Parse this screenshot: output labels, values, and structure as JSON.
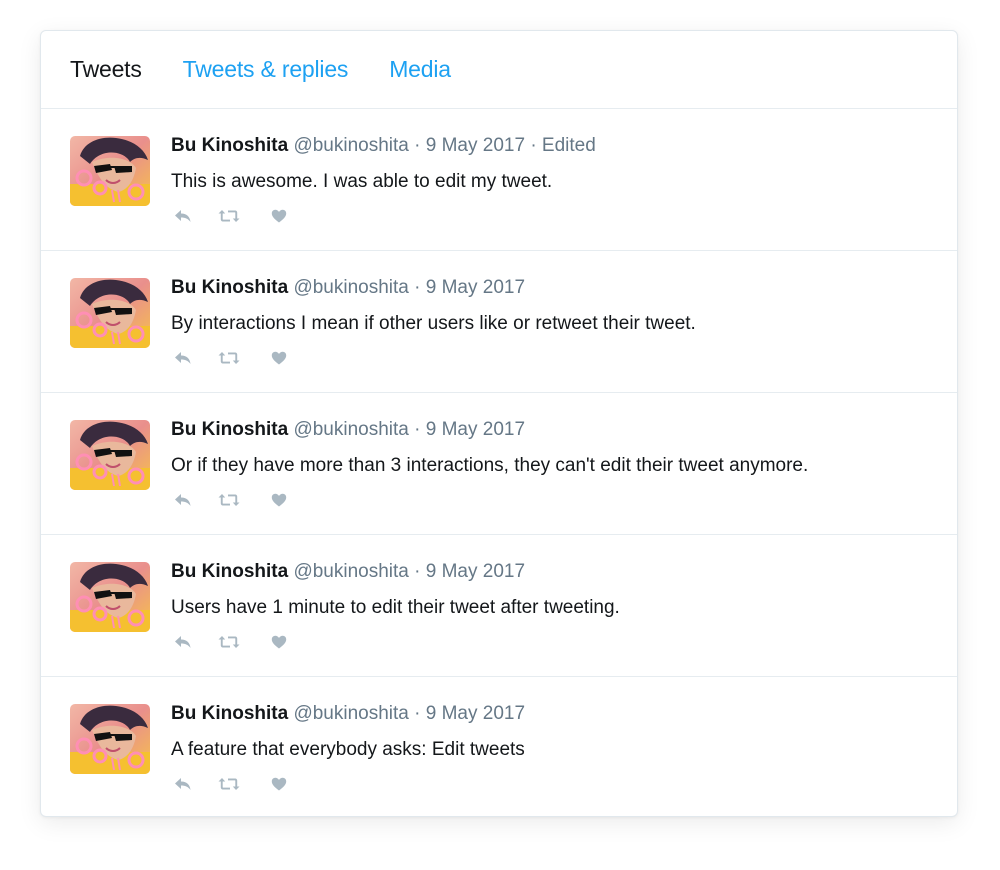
{
  "tabs": [
    {
      "label": "Tweets",
      "active": true
    },
    {
      "label": "Tweets & replies",
      "active": false
    },
    {
      "label": "Media",
      "active": false
    }
  ],
  "colors": {
    "accent": "#1da1f2",
    "text": "#14171a",
    "muted": "#657786",
    "icon": "#aab8c2",
    "border": "#e6ecf0"
  },
  "icons": [
    "reply-icon",
    "retweet-icon",
    "like-icon"
  ],
  "tweets": [
    {
      "name": "Bu Kinoshita",
      "meta": "@bukinoshita · 9 May 2017 · Edited",
      "text": "This is awesome. I was able to edit my tweet."
    },
    {
      "name": "Bu Kinoshita",
      "meta": "@bukinoshita · 9 May 2017",
      "text": "By interactions I mean if other users like or retweet their tweet."
    },
    {
      "name": "Bu Kinoshita",
      "meta": "@bukinoshita · 9 May 2017",
      "text": "Or if they have more than 3 interactions, they can't edit their tweet anymore."
    },
    {
      "name": "Bu Kinoshita",
      "meta": "@bukinoshita · 9 May 2017",
      "text": "Users have 1 minute to edit their tweet after tweeting."
    },
    {
      "name": "Bu Kinoshita",
      "meta": "@bukinoshita · 9 May 2017",
      "text": "A feature that everybody asks: Edit tweets"
    }
  ]
}
